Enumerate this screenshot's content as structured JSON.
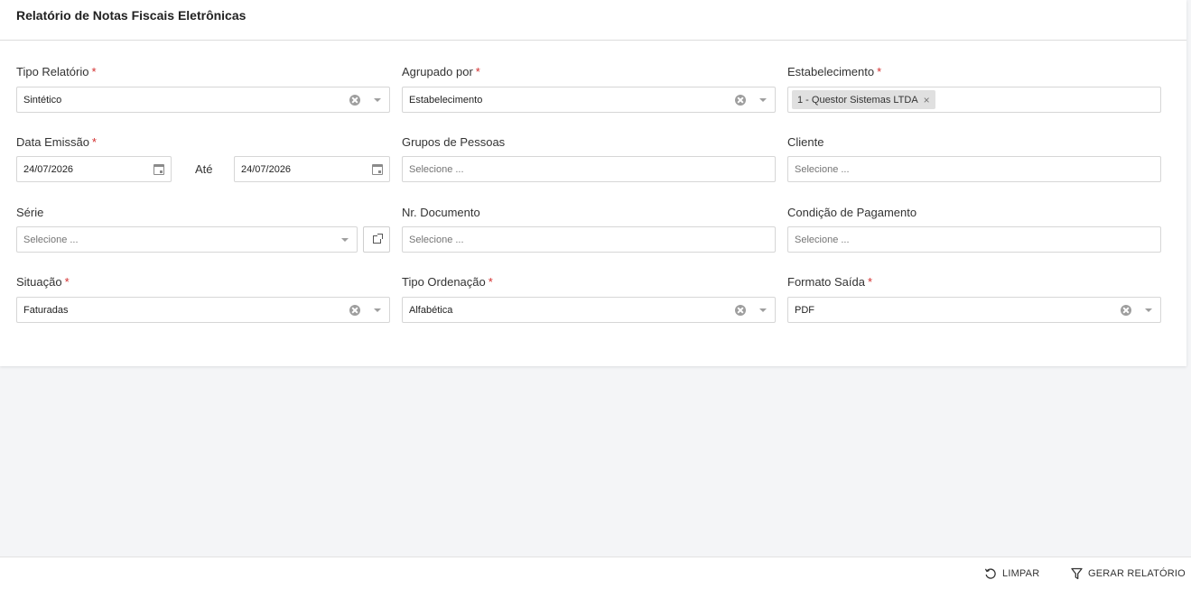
{
  "page": {
    "title": "Relatório de Notas Fiscais Eletrônicas"
  },
  "form": {
    "tipo_relatorio": {
      "label": "Tipo Relatório",
      "required": "*",
      "value": "Sintético"
    },
    "agrupado_por": {
      "label": "Agrupado por",
      "required": "*",
      "value": "Estabelecimento"
    },
    "estabelecimento": {
      "label": "Estabelecimento",
      "required": "*",
      "chip": "1 - Questor Sistemas LTDA",
      "chip_remove": "×"
    },
    "data_emissao": {
      "label": "Data Emissão",
      "required": "*",
      "from": "24/07/2026",
      "to_label": "Até",
      "to": "24/07/2026"
    },
    "grupos_pessoas": {
      "label": "Grupos de Pessoas",
      "placeholder": "Selecione ..."
    },
    "cliente": {
      "label": "Cliente",
      "placeholder": "Selecione ..."
    },
    "serie": {
      "label": "Série",
      "placeholder": "Selecione ..."
    },
    "nr_documento": {
      "label": "Nr. Documento",
      "placeholder": "Selecione ..."
    },
    "condicao_pagamento": {
      "label": "Condição de Pagamento",
      "placeholder": "Selecione ..."
    },
    "situacao": {
      "label": "Situação",
      "required": "*",
      "value": "Faturadas"
    },
    "tipo_ordenacao": {
      "label": "Tipo Ordenação",
      "required": "*",
      "value": "Alfabética"
    },
    "formato_saida": {
      "label": "Formato Saída",
      "required": "*",
      "value": "PDF"
    }
  },
  "footer": {
    "clear_label": "LIMPAR",
    "clear_icon": "refresh-icon",
    "generate_label": "GERAR RELATÓRIO",
    "generate_icon": "filter-icon"
  },
  "colors": {
    "required": "#d32f2f",
    "background": "#f4f5f7",
    "card": "#ffffff"
  }
}
